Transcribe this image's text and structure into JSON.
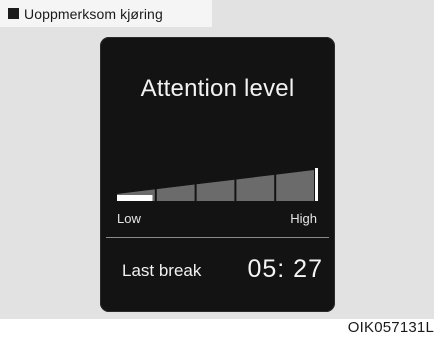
{
  "caption": {
    "text": "Uoppmerksom kjøring"
  },
  "display": {
    "title": "Attention level",
    "gauge": {
      "segments_total": 5,
      "level_fraction": 0.18,
      "low_label": "Low",
      "high_label": "High"
    },
    "last_break": {
      "label": "Last break",
      "time": "05: 27"
    }
  },
  "figure_code": "OIK057131L",
  "colors": {
    "screen_bg": "#131313",
    "segment_fill": "#6b6b6b",
    "active_fill": "#ffffff",
    "frame_bg": "#e2e2e2"
  }
}
